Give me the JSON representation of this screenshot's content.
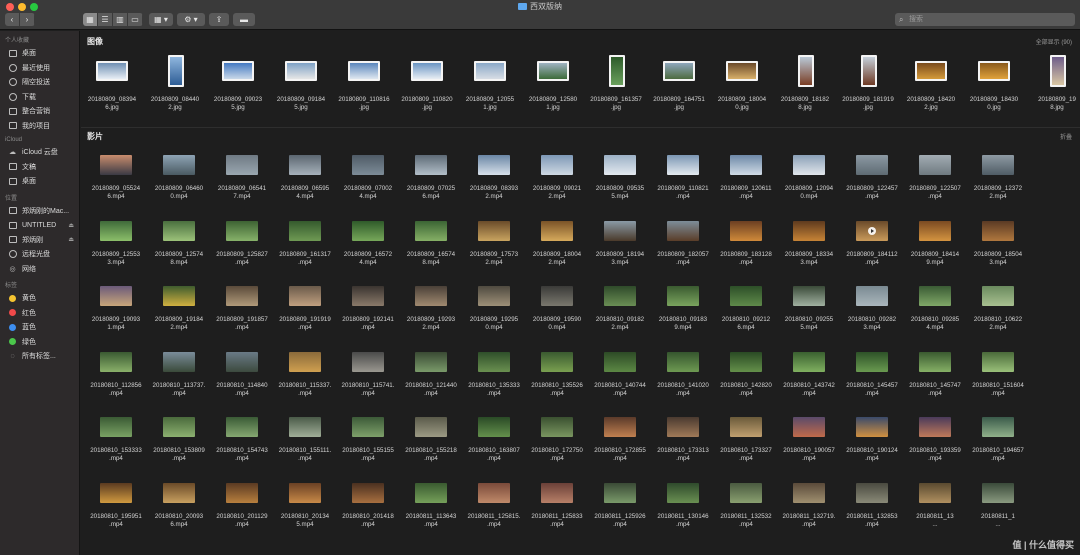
{
  "window": {
    "title": "西双版纳"
  },
  "toolbar": {
    "back_icon": "chevron-left-icon",
    "forward_icon": "chevron-right-icon",
    "views": [
      "icon-view-icon",
      "list-view-icon",
      "column-view-icon",
      "gallery-view-icon"
    ],
    "group_icon": "group-grid-icon",
    "action_icon": "gear-icon",
    "share_icon": "share-icon",
    "tag_icon": "tag-icon",
    "search_placeholder": "搜索"
  },
  "sidebar": {
    "sections": [
      {
        "title": "个人收藏",
        "items": [
          {
            "label": "桌面",
            "icon": "desktop-icon"
          },
          {
            "label": "最近使用",
            "icon": "recents-icon"
          },
          {
            "label": "隔空投送",
            "icon": "airdrop-icon"
          },
          {
            "label": "下载",
            "icon": "download-icon"
          },
          {
            "label": "整合营销",
            "icon": "folder-icon"
          },
          {
            "label": "我的项目",
            "icon": "folder-icon"
          }
        ]
      },
      {
        "title": "iCloud",
        "items": [
          {
            "label": "iCloud 云盘",
            "icon": "cloud-icon"
          },
          {
            "label": "文稿",
            "icon": "document-icon"
          },
          {
            "label": "桌面",
            "icon": "desktop-icon"
          }
        ]
      },
      {
        "title": "位置",
        "items": [
          {
            "label": "郑炳刚的Mac...",
            "icon": "laptop-icon"
          },
          {
            "label": "UNTITLED",
            "icon": "drive-icon",
            "eject": true
          },
          {
            "label": "郑炳刚",
            "icon": "drive-icon",
            "eject": true
          },
          {
            "label": "远程光盘",
            "icon": "disc-icon"
          },
          {
            "label": "网络",
            "icon": "network-icon"
          }
        ]
      },
      {
        "title": "标签",
        "items": [
          {
            "label": "黄色",
            "icon": "tag-dot-icon",
            "color": "#f5c431"
          },
          {
            "label": "红色",
            "icon": "tag-dot-icon",
            "color": "#f0494a"
          },
          {
            "label": "蓝色",
            "icon": "tag-dot-icon",
            "color": "#3d8ef0"
          },
          {
            "label": "绿色",
            "icon": "tag-dot-icon",
            "color": "#4bc74b"
          },
          {
            "label": "所有标签...",
            "icon": "all-tags-icon"
          }
        ]
      }
    ]
  },
  "images": {
    "title": "图像",
    "action": "全部显示 (90)",
    "items": [
      {
        "name": "20180809_083946.jpg",
        "line1": "20180809_08394",
        "line2": "6.jpg",
        "c1": "#6f8fb3",
        "c2": "#e8eef5"
      },
      {
        "name": "20180809_084402.jpg",
        "line1": "20180809_08440",
        "line2": "2.jpg",
        "c1": "#8fb6de",
        "c2": "#2e5d95",
        "tall": true
      },
      {
        "name": "20180809_090235.jpg",
        "line1": "20180809_09023",
        "line2": "5.jpg",
        "c1": "#4479c2",
        "c2": "#c9d8e8"
      },
      {
        "name": "20180809_091845.jpg",
        "line1": "20180809_09184",
        "line2": "5.jpg",
        "c1": "#7fa2c6",
        "c2": "#e6e6e6"
      },
      {
        "name": "20180809_110816.jpg",
        "line1": "20180809_110816",
        "line2": ".jpg",
        "c1": "#5b87bd",
        "c2": "#dfe7f0"
      },
      {
        "name": "20180809_110820.jpg",
        "line1": "20180809_110820",
        "line2": ".jpg",
        "c1": "#6a95c4",
        "c2": "#e8edf3"
      },
      {
        "name": "20180809_120551.jpg",
        "line1": "20180809_12055",
        "line2": "1.jpg",
        "c1": "#8aa8c8",
        "c2": "#d7dde4"
      },
      {
        "name": "20180809_125801.jpg",
        "line1": "20180809_12580",
        "line2": "1.jpg",
        "c1": "#9fb3c2",
        "c2": "#3d6b3a"
      },
      {
        "name": "20180809_161357.jpg",
        "line1": "20180809_161357",
        "line2": ".jpg",
        "c1": "#2d5a2a",
        "c2": "#6aa05c",
        "tall": true
      },
      {
        "name": "20180809_164751.jpg",
        "line1": "20180809_164751",
        "line2": ".jpg",
        "c1": "#8fa7bd",
        "c2": "#4d6b3f"
      },
      {
        "name": "20180809_180040.jpg",
        "line1": "20180809_18004",
        "line2": "0.jpg",
        "c1": "#6b4a2a",
        "c2": "#d8b06a"
      },
      {
        "name": "20180809_181828.jpg",
        "line1": "20180809_18182",
        "line2": "8.jpg",
        "c1": "#b9c8d6",
        "c2": "#7a3e25",
        "tall": true
      },
      {
        "name": "20180809_181919.jpg",
        "line1": "20180809_181919",
        "line2": ".jpg",
        "c1": "#c5d0da",
        "c2": "#6e3a24",
        "tall": true
      },
      {
        "name": "20180809_184202.jpg",
        "line1": "20180809_18420",
        "line2": "2.jpg",
        "c1": "#7a4b1c",
        "c2": "#d49a3a"
      },
      {
        "name": "20180809_184300.jpg",
        "line1": "20180809_18430",
        "line2": "0.jpg",
        "c1": "#8a5a1c",
        "c2": "#e0a23c"
      },
      {
        "name": "20180809_1928.jpg",
        "line1": "20180809_19",
        "line2": "8.jpg",
        "c1": "#6e5d8a",
        "c2": "#d9c7a3",
        "tall": true
      }
    ]
  },
  "movies": {
    "title": "影片",
    "action": "折叠",
    "rows": [
      [
        [
          "20180809_05524",
          "6.mp4",
          "#c98d6e",
          "#3a3a44"
        ],
        [
          "20180809_06460",
          "0.mp4",
          "#8ea4b5",
          "#4a5a62"
        ],
        [
          "20180809_06541",
          "7.mp4",
          "#6f7a84",
          "#9aa7b0"
        ],
        [
          "20180809_06595",
          "4.mp4",
          "#5b6670",
          "#a7b2bb"
        ],
        [
          "20180809_07002",
          "4.mp4",
          "#4f5b66",
          "#7d8c98"
        ],
        [
          "20180809_07025",
          "6.mp4",
          "#5d6a76",
          "#b2bec8"
        ],
        [
          "20180809_08393",
          "2.mp4",
          "#6a86a5",
          "#d7e0ea"
        ],
        [
          "20180809_09021",
          "2.mp4",
          "#7d98b6",
          "#cfd9e3"
        ],
        [
          "20180809_09535",
          "5.mp4",
          "#9cb1c6",
          "#e3e9ef"
        ],
        [
          "20180809_110821",
          ".mp4",
          "#7b96b3",
          "#e4eaf0"
        ],
        [
          "20180809_120611",
          ".mp4",
          "#6d88a7",
          "#d0dbe6"
        ],
        [
          "20180809_12094",
          "0.mp4",
          "#8aa0b7",
          "#e1e6eb"
        ],
        [
          "20180809_122457",
          ".mp4",
          "#8c99a3",
          "#5e6b73"
        ],
        [
          "20180809_122507",
          ".mp4",
          "#a2acb3",
          "#6f7a80"
        ],
        [
          "20180809_12372",
          "2.mp4",
          "#8e9aa3",
          "#4f5c65"
        ]
      ],
      [
        [
          "20180809_12553",
          "3.mp4",
          "#3f6a3a",
          "#8cbf6a"
        ],
        [
          "20180809_12574",
          "8.mp4",
          "#4a6f3f",
          "#9cc27a"
        ],
        [
          "20180809_125827",
          ".mp4",
          "#3d6233",
          "#87b26a"
        ],
        [
          "20180809_161317",
          ".mp4",
          "#355a2d",
          "#6f9a54"
        ],
        [
          "20180809_16572",
          "4.mp4",
          "#2f5a2a",
          "#77a85a"
        ],
        [
          "20180809_16574",
          "8.mp4",
          "#3b6434",
          "#86b066"
        ],
        [
          "20180809_17573",
          "2.mp4",
          "#6a4b2a",
          "#c9a460"
        ],
        [
          "20180809_18004",
          "2.mp4",
          "#7a5328",
          "#d6aa5c"
        ],
        [
          "20180809_18194",
          "3.mp4",
          "#8a9aa6",
          "#4a3a2a"
        ],
        [
          "20180809_182057",
          ".mp4",
          "#7d8d99",
          "#5a3d28"
        ],
        [
          "20180809_183128",
          ".mp4",
          "#6b3f22",
          "#d08a3a"
        ],
        [
          "20180809_18334",
          "3.mp4",
          "#5e3a1e",
          "#c78436"
        ],
        [
          "20180809_184112",
          ".mp4",
          "#6a4a2a",
          "#c99a5a",
          "play"
        ],
        [
          "20180809_18414",
          "9.mp4",
          "#7a4a22",
          "#d49440"
        ],
        [
          "20180809_18504",
          "3.mp4",
          "#5a3a24",
          "#b0783e"
        ]
      ],
      [
        [
          "20180809_19093",
          "1.mp4",
          "#6b5a7a",
          "#c8a67a"
        ],
        [
          "20180809_19184",
          "2.mp4",
          "#3f5c2e",
          "#d0b040"
        ],
        [
          "20180809_191857",
          ".mp4",
          "#5a4a3a",
          "#b09a7a"
        ],
        [
          "20180809_191919",
          ".mp4",
          "#6a5a4a",
          "#c0a080"
        ],
        [
          "20180809_192141",
          ".mp4",
          "#3a3430",
          "#8a7a6a"
        ],
        [
          "20180809_19293",
          "2.mp4",
          "#4a4038",
          "#a08a70"
        ],
        [
          "20180809_19295",
          "0.mp4",
          "#4f4a40",
          "#9d9078"
        ],
        [
          "20180809_19590",
          "0.mp4",
          "#3a3a38",
          "#7a786e"
        ],
        [
          "20180810_09182",
          "2.mp4",
          "#2f4a2a",
          "#6a8e54"
        ],
        [
          "20180810_09183",
          "9.mp4",
          "#3a5a30",
          "#7aa45e"
        ],
        [
          "20180810_09212",
          "6.mp4",
          "#2d4f28",
          "#5f8a4a"
        ],
        [
          "20180810_09255",
          "5.mp4",
          "#3a4a38",
          "#a0b0a0"
        ],
        [
          "20180810_09282",
          "3.mp4",
          "#7a8a92",
          "#aab6bc"
        ],
        [
          "20180810_09285",
          "4.mp4",
          "#3a5a34",
          "#80a868"
        ],
        [
          "20180810_10622",
          "2.mp4",
          "#6a8a5e",
          "#a8c090"
        ]
      ],
      [
        [
          "20180810_112856",
          ".mp4",
          "#3a5a32",
          "#8ab06a"
        ],
        [
          "20180810_113737.",
          ".mp4",
          "#7a8c9a",
          "#3a4a3a"
        ],
        [
          "20180810_114840",
          ".mp4",
          "#6a7a86",
          "#3c4a3e"
        ],
        [
          "20180810_115337.",
          ".mp4",
          "#8a6a3a",
          "#d0a050"
        ],
        [
          "20180810_115741.",
          ".mp4",
          "#4a4a4a",
          "#9a9890"
        ],
        [
          "20180810_121440",
          ".mp4",
          "#3a4a34",
          "#7a9a6a"
        ],
        [
          "20180810_135333",
          ".mp4",
          "#2f4f2a",
          "#6a9050"
        ],
        [
          "20180810_135526",
          ".mp4",
          "#3a5a30",
          "#7aa050"
        ],
        [
          "20180810_140744",
          ".mp4",
          "#2d4a26",
          "#5c8844"
        ],
        [
          "20180810_141020",
          ".mp4",
          "#35552e",
          "#6e9a52"
        ],
        [
          "20180810_142820",
          ".mp4",
          "#2a4a24",
          "#64904a"
        ],
        [
          "20180810_143742",
          ".mp4",
          "#3a6030",
          "#80b060"
        ],
        [
          "20180810_145457",
          ".mp4",
          "#2e5228",
          "#6a9a50"
        ],
        [
          "20180810_145747",
          ".mp4",
          "#3a5a30",
          "#86b066"
        ],
        [
          "20180810_151604",
          ".mp4",
          "#4a6a3a",
          "#9ac07a"
        ]
      ],
      [
        [
          "20180810_153333",
          ".mp4",
          "#3a5a34",
          "#7aa264"
        ],
        [
          "20180810_153809",
          ".mp4",
          "#4a6a3c",
          "#8cb070"
        ],
        [
          "20180810_154743",
          ".mp4",
          "#3a5a36",
          "#86a872"
        ],
        [
          "20180810_155111.",
          ".mp4",
          "#4a5a48",
          "#a0ae98"
        ],
        [
          "20180810_155155",
          ".mp4",
          "#3c5a38",
          "#7ea06a"
        ],
        [
          "20180810_155218",
          ".mp4",
          "#5a5a4a",
          "#9c9a84"
        ],
        [
          "20180810_163807",
          ".mp4",
          "#2a4a26",
          "#64904c"
        ],
        [
          "20180810_172750",
          ".mp4",
          "#3a5030",
          "#7a9660"
        ],
        [
          "20180810_172855",
          ".mp4",
          "#5a3a2a",
          "#c08050"
        ],
        [
          "20180810_173313",
          ".mp4",
          "#4a3a30",
          "#a07a58"
        ],
        [
          "20180810_173327",
          ".mp4",
          "#6a5a3a",
          "#c0a070"
        ],
        [
          "20180810_190057",
          ".mp4",
          "#5a4a6a",
          "#c06a4a"
        ],
        [
          "20180810_190124",
          ".mp4",
          "#3a4a6a",
          "#d09040"
        ],
        [
          "20180810_193359",
          ".mp4",
          "#4a3a5a",
          "#c07a5a"
        ],
        [
          "20180810_194657",
          ".mp4",
          "#3a5a4a",
          "#90b08a"
        ]
      ],
      [
        [
          "20180810_195951",
          ".mp4",
          "#5a3a20",
          "#d09a40"
        ],
        [
          "20180810_20093",
          "6.mp4",
          "#6a4a28",
          "#c8a060"
        ],
        [
          "20180810_201129",
          ".mp4",
          "#5a3a22",
          "#b8803e"
        ],
        [
          "20180810_20134",
          "5.mp4",
          "#6a4024",
          "#c88a48"
        ],
        [
          "20180810_201418",
          ".mp4",
          "#4a3020",
          "#a87040"
        ],
        [
          "20180811_113643",
          ".mp4",
          "#3a5a30",
          "#76a05a"
        ],
        [
          "20180811_125815.",
          ".mp4",
          "#7a4a3a",
          "#c08a6a"
        ],
        [
          "20180811_125833",
          ".mp4",
          "#6a4038",
          "#b88068"
        ],
        [
          "20180811_125926",
          ".mp4",
          "#3a4a36",
          "#7a9a6a"
        ],
        [
          "20180811_130146",
          ".mp4",
          "#2f4a2c",
          "#6a9052"
        ],
        [
          "20180811_132532",
          ".mp4",
          "#4a5a40",
          "#8aa070"
        ],
        [
          "20180811_132719.",
          ".mp4",
          "#5a4a3a",
          "#a09070"
        ],
        [
          "20180811_132853",
          ".mp4",
          "#4a4a40",
          "#8a8a78"
        ],
        [
          "20180811_13",
          "...",
          "#5a4a30",
          "#b09060"
        ],
        [
          "20180811_1",
          "...",
          "#3a4a3a",
          "#8a9a80"
        ]
      ]
    ]
  },
  "watermark": "值 | 什么值得买"
}
